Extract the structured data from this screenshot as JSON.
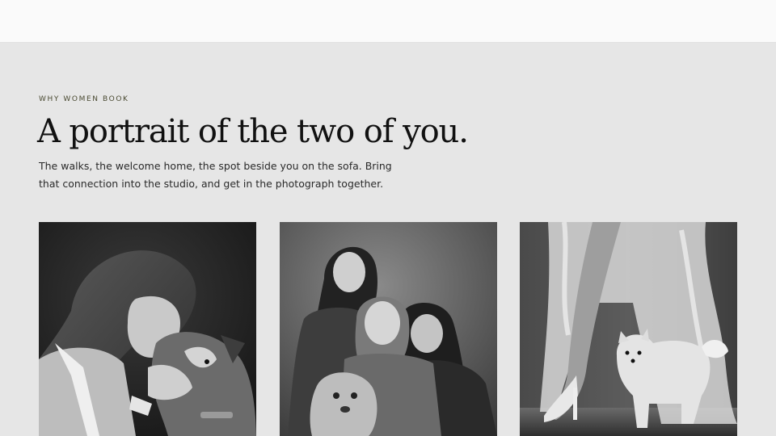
{
  "section": {
    "eyebrow": "WHY WOMEN BOOK",
    "headline": "A portrait of the two of you.",
    "intro": "The walks, the welcome home, the spot beside you on the sofa. Bring that connection into the studio, and get in the photograph together."
  },
  "gallery": {
    "photos": [
      {
        "name": "woman-with-dog-photo"
      },
      {
        "name": "mother-daughters-dog-photo"
      },
      {
        "name": "legs-with-pomeranian-photo"
      }
    ]
  },
  "colors": {
    "page_background": "#e6e6e6",
    "header_background": "#fafafa",
    "eyebrow_text": "#4a4a32",
    "headline_text": "#111111",
    "body_text": "#2a2a2a"
  }
}
